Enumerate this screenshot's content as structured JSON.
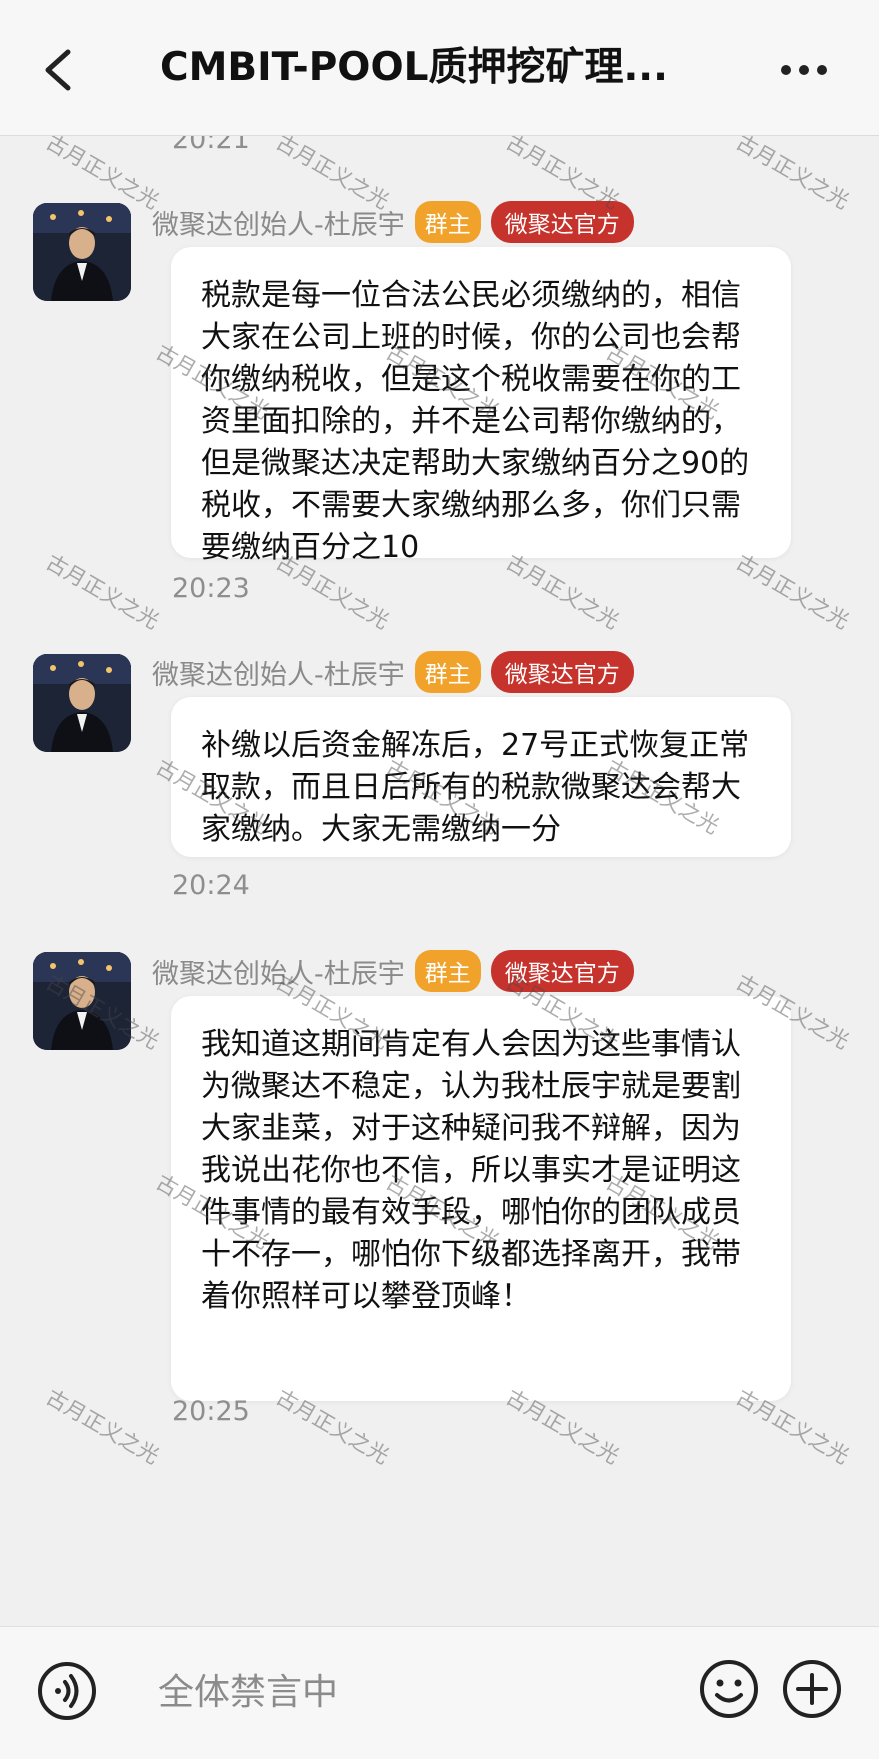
{
  "header": {
    "title": "CMBIT-POOL质押挖矿理...",
    "back_icon": "back-arrow-icon",
    "more_icon": "more-dots-icon"
  },
  "messages": [
    {
      "time": "20:21"
    },
    {
      "sender": "微聚达创始人-杜辰宇",
      "badge_owner": "群主",
      "badge_official": "微聚达官方",
      "text": "税款是每一位合法公民必须缴纳的，相信大家在公司上班的时候，你的公司也会帮你缴纳税收，但是这个税收需要在你的工资里面扣除的，并不是公司帮你缴纳的，但是微聚达决定帮助大家缴纳百分之90的税收，不需要大家缴纳那么多，你们只需要缴纳百分之10",
      "time": "20:23"
    },
    {
      "sender": "微聚达创始人-杜辰宇",
      "badge_owner": "群主",
      "badge_official": "微聚达官方",
      "text": "补缴以后资金解冻后，27号正式恢复正常取款，而且日后所有的税款微聚达会帮大家缴纳。大家无需缴纳一分",
      "time": "20:24"
    },
    {
      "sender": "微聚达创始人-杜辰宇",
      "badge_owner": "群主",
      "badge_official": "微聚达官方",
      "text": "我知道这期间肯定有人会因为这些事情认为微聚达不稳定，认为我杜辰宇就是要割大家韭菜，对于这种疑问我不辩解，因为我说出花你也不信，所以事实才是证明这件事情的最有效手段，哪怕你的团队成员十不存一，哪怕你下级都选择离开，我带着你照样可以攀登顶峰！",
      "time": "20:25"
    }
  ],
  "watermark": "古月正义之光",
  "footer": {
    "input_placeholder": "全体禁言中",
    "voice_icon": "voice-icon",
    "emoji_icon": "emoji-icon",
    "plus_icon": "plus-icon"
  },
  "colors": {
    "owner_badge": "#f0a22a",
    "official_badge": "#c6332c",
    "background": "#f0f0f0"
  }
}
